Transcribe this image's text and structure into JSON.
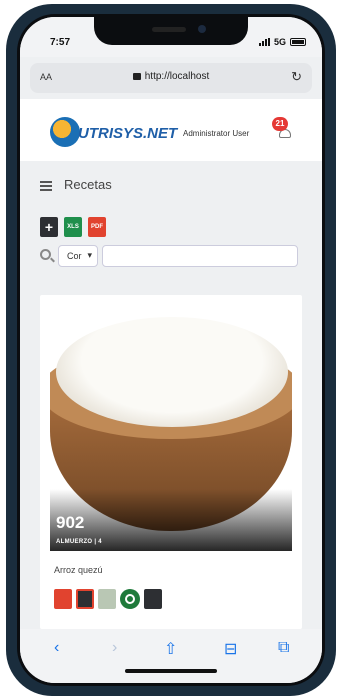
{
  "status": {
    "time": "7:57",
    "network": "5G"
  },
  "browser": {
    "text_size_label": "AA",
    "url": "http://localhost",
    "reload_glyph": "↻"
  },
  "app": {
    "logo": "UTRISYS.NET",
    "user": "Administrator User",
    "notifications": "21",
    "section": "Recetas"
  },
  "tools": {
    "xls": "XLS",
    "pdf": "PDF"
  },
  "filter": {
    "field": "Cor",
    "field_chevron": "▾",
    "query": ""
  },
  "recipe": {
    "kcal": "902",
    "meal_info": "ALMUERZO | 4",
    "name": "Arroz quezú"
  },
  "toolbar": {
    "back": "‹",
    "forward": "›",
    "share": "⇧",
    "bookmarks": "⊟",
    "tabs": "⧉"
  },
  "colors": {
    "accent": "#1a74e8",
    "brand": "#1f5fa8",
    "badge": "#e53935"
  }
}
